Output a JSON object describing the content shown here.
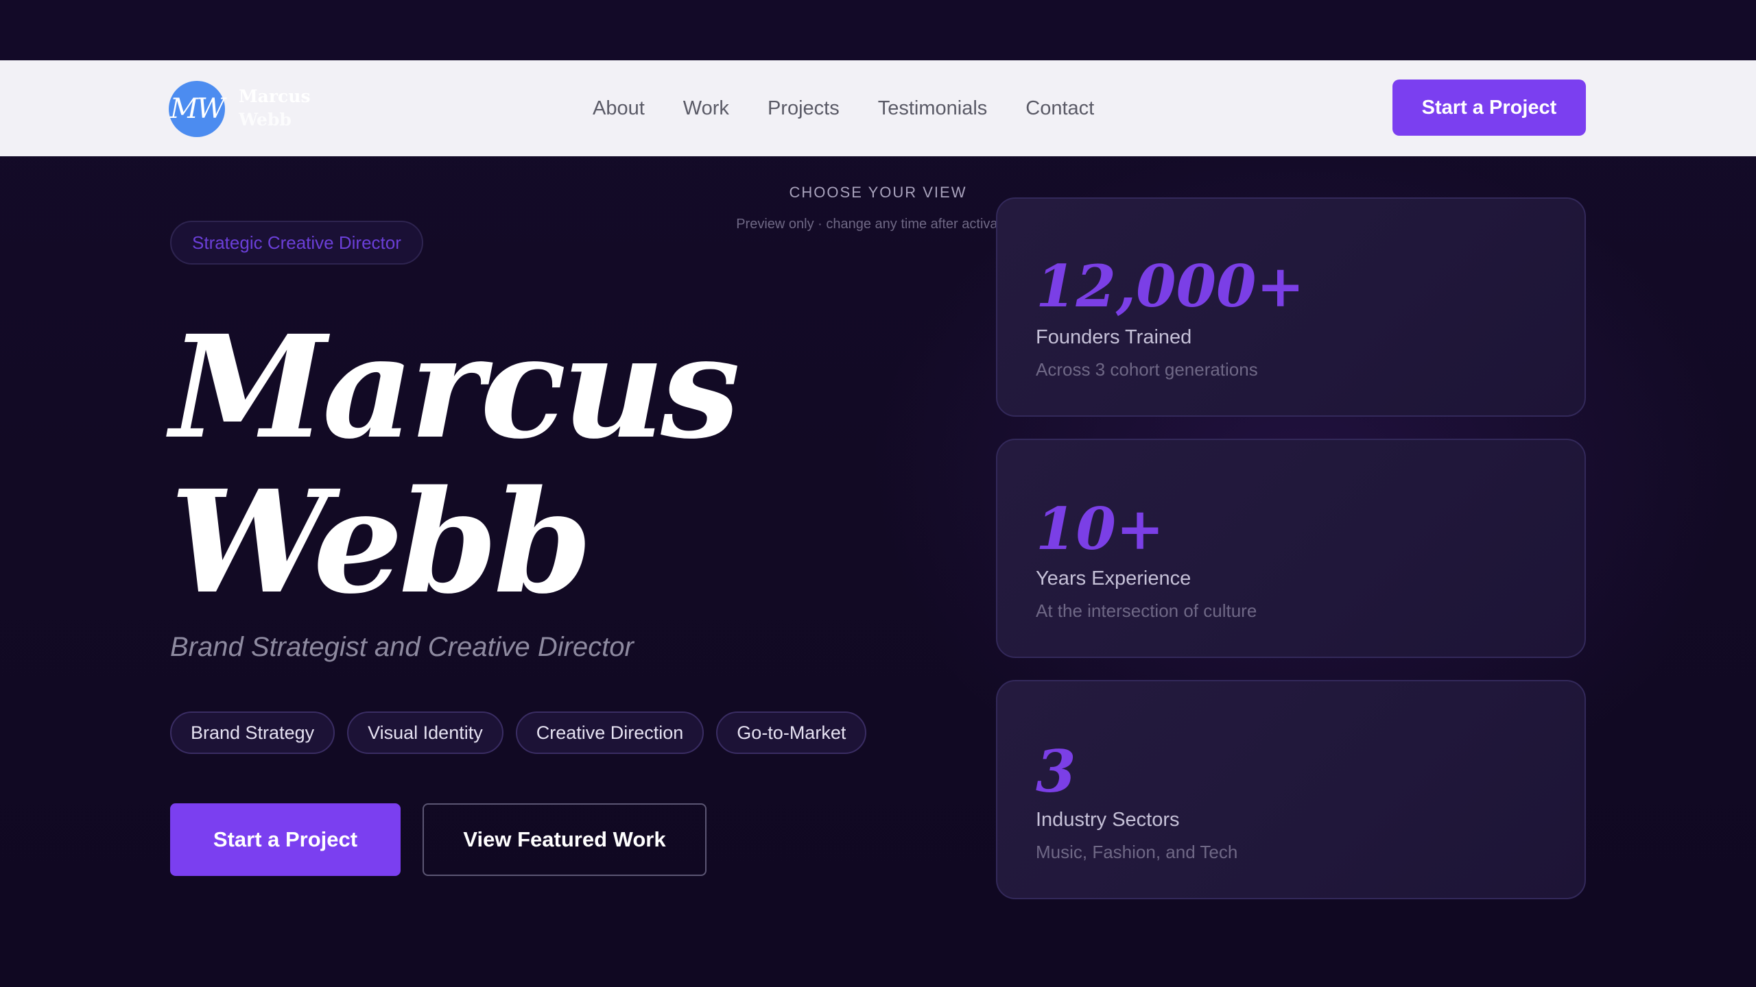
{
  "nav": {
    "logo_monogram": "MW",
    "logo_line1": "Marcus",
    "logo_line2": "Webb",
    "links": [
      "About",
      "Work",
      "Projects",
      "Testimonials",
      "Contact"
    ],
    "cta_label": "Start a Project"
  },
  "view_chooser": {
    "title": "CHOOSE YOUR VIEW",
    "subtitle": "Preview only · change any time after activation"
  },
  "hero": {
    "role_pill": "Strategic Creative Director",
    "name_line1": "Marcus",
    "name_line2": "Webb",
    "subtitle": "Brand Strategist and Creative Director",
    "tags": [
      "Brand Strategy",
      "Visual Identity",
      "Creative Direction",
      "Go-to-Market"
    ],
    "primary_button": "Start a Project",
    "secondary_button": "View Featured Work"
  },
  "stats": [
    {
      "value": "12,000+",
      "label": "Founders Trained",
      "note": "Across 3 cohort generations"
    },
    {
      "value": "10+",
      "label": "Years Experience",
      "note": "At the intersection of culture"
    },
    {
      "value": "3",
      "label": "Industry Sectors",
      "note": "Music, Fashion, and Tech"
    }
  ],
  "colors": {
    "accent": "#7b3ff0",
    "background": "#130a26",
    "navbar": "#f2f1f6",
    "logo_badge": "#4c8cf0"
  }
}
